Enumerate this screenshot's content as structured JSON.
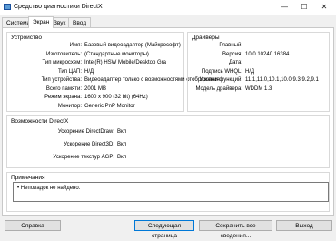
{
  "window": {
    "title": "Средство диагностики DirectX",
    "controls": {
      "minimize": "—",
      "maximize": "☐",
      "close": "✕"
    }
  },
  "tabs": [
    "Система",
    "Экран",
    "Звук",
    "Ввод"
  ],
  "active_tab": "Экран",
  "device": {
    "title": "Устройство",
    "rows": [
      {
        "label": "Имя:",
        "value": "Базовый видеоадаптер (Майкрософт)"
      },
      {
        "label": "Изготовитель:",
        "value": "(Стандартные мониторы)"
      },
      {
        "label": "Тип микросхем:",
        "value": "Intel(R) HSW Mobile/Desktop Gra"
      },
      {
        "label": "Тип ЦАП:",
        "value": "Н/Д"
      },
      {
        "label": "Тип устройства:",
        "value": "Видеоадаптер только с возможностями отображения"
      },
      {
        "label": "Всего памяти:",
        "value": "2001 MB"
      },
      {
        "label": "Режим экрана:",
        "value": "1600 x 900 (32 bit) (64Hz)"
      },
      {
        "label": "Монитор:",
        "value": "Generic PnP Monitor"
      }
    ]
  },
  "drivers": {
    "title": "Драйверы",
    "rows": [
      {
        "label": "Главный:",
        "value": ""
      },
      {
        "label": "Версия:",
        "value": "10.0.10240.16384"
      },
      {
        "label": "Дата:",
        "value": ""
      },
      {
        "label": "Подпись WHQL:",
        "value": "Н/Д"
      },
      {
        "label": "Уровни функций:",
        "value": "11.1,11.0,10.1,10.0,9.3,9.2,9.1"
      },
      {
        "label": "Модель драйвера:",
        "value": "WDDM 1.3"
      }
    ]
  },
  "directx": {
    "title": "Возможности DirectX",
    "rows": [
      {
        "label": "Ускорение DirectDraw:",
        "value": "Вкл"
      },
      {
        "label": "Ускорение Direct3D:",
        "value": "Вкл"
      },
      {
        "label": "Ускорение текстур AGP:",
        "value": "Вкл"
      }
    ]
  },
  "notes": {
    "title": "Примечания",
    "items": [
      "Неполадок не найдено."
    ]
  },
  "buttons": {
    "help": "Справка",
    "next": "Следующая страница",
    "save": "Сохранить все сведения...",
    "exit": "Выход"
  }
}
